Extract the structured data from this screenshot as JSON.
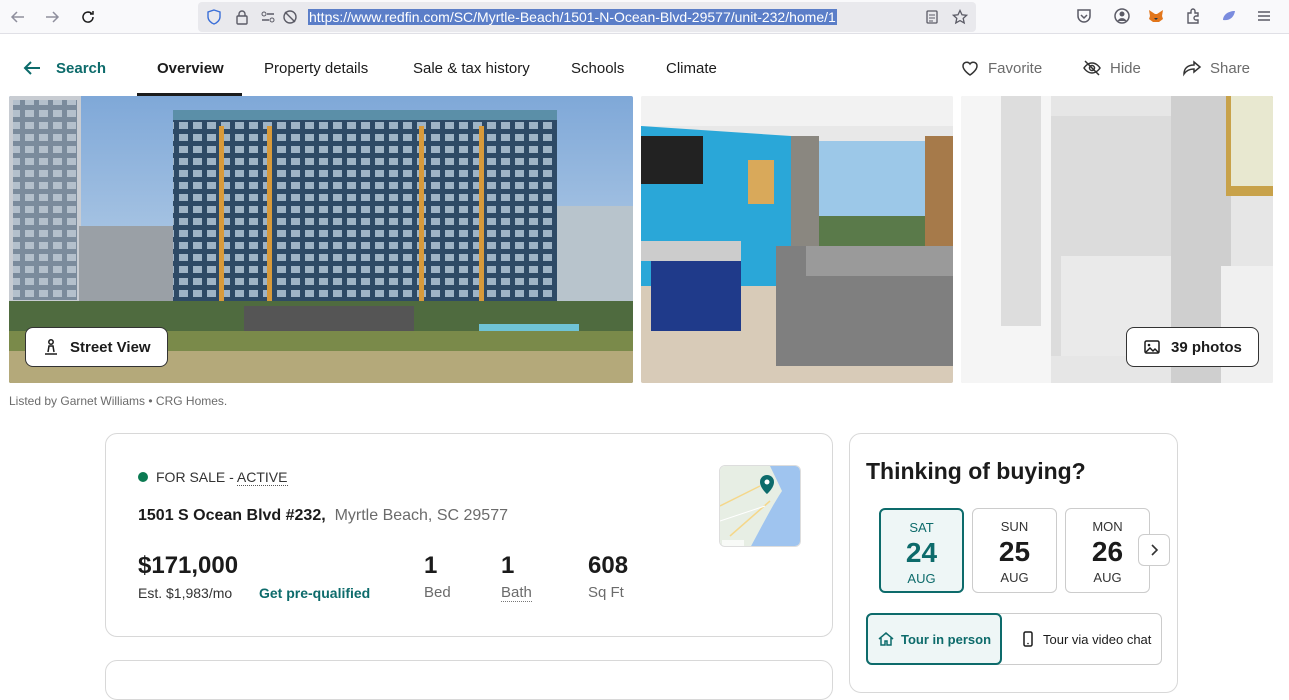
{
  "browser": {
    "url": "https://www.redfin.com/SC/Myrtle-Beach/1501-N-Ocean-Blvd-29577/unit-232/home/1"
  },
  "nav": {
    "back_label": "Search",
    "tabs": [
      {
        "label": "Overview"
      },
      {
        "label": "Property details"
      },
      {
        "label": "Sale & tax history"
      },
      {
        "label": "Schools"
      },
      {
        "label": "Climate"
      }
    ],
    "actions": {
      "favorite": "Favorite",
      "hide": "Hide",
      "share": "Share"
    }
  },
  "photos": {
    "street_view_label": "Street View",
    "photos_count_label": "39 photos",
    "listed_by": "Listed by Garnet Williams • CRG Homes."
  },
  "listing": {
    "status_prefix": "FOR SALE - ",
    "status_word": "ACTIVE",
    "status_color": "#0b7a52",
    "street": "1501 S Ocean Blvd #232,",
    "city": "Myrtle Beach, SC 29577",
    "price": "$171,000",
    "est_payment": "Est. $1,983/mo",
    "prequal_label": "Get pre-qualified",
    "beds": {
      "value": "1",
      "label": "Bed"
    },
    "baths": {
      "value": "1",
      "label": "Bath"
    },
    "sqft": {
      "value": "608",
      "label": "Sq Ft"
    }
  },
  "tour": {
    "title": "Thinking of buying?",
    "days": [
      {
        "dow": "SAT",
        "num": "24",
        "mon": "AUG",
        "selected": true
      },
      {
        "dow": "SUN",
        "num": "25",
        "mon": "AUG",
        "selected": false
      },
      {
        "dow": "MON",
        "num": "26",
        "mon": "AUG",
        "selected": false
      }
    ],
    "in_person": "Tour in person",
    "video_chat": "Tour via video chat"
  },
  "colors": {
    "brand": "#0d6b6b",
    "text": "#1b1b1b"
  }
}
